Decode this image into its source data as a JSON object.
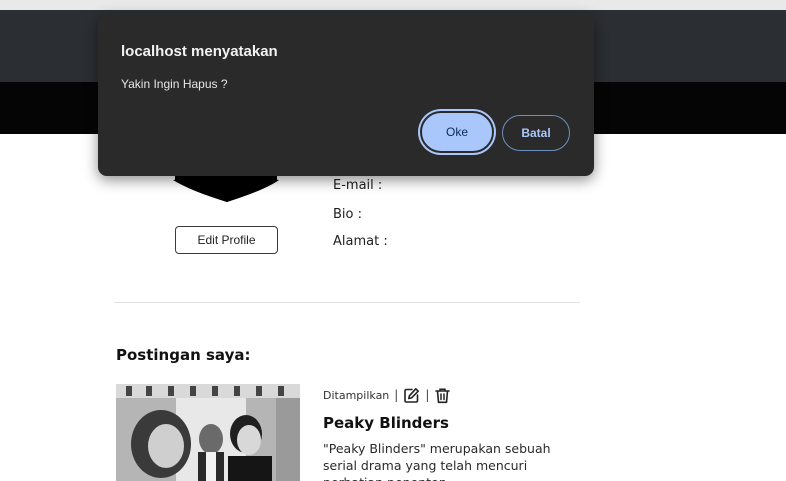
{
  "dialog": {
    "title": "localhost menyatakan",
    "message": "Yakin Ingin Hapus ?",
    "ok_label": "Oke",
    "cancel_label": "Batal"
  },
  "profile": {
    "edit_button": "Edit Profile",
    "email_label": "E-mail :",
    "bio_label": "Bio :",
    "address_label": "Alamat :"
  },
  "posts_section": {
    "title": "Postingan saya:",
    "posts": [
      {
        "status": "Ditampilkan",
        "separator": "|",
        "title": "Peaky Blinders",
        "excerpt": "\"Peaky Blinders\" merupakan sebuah serial drama yang telah mencuri perhatian penonton",
        "icons": [
          "edit-icon",
          "trash-icon"
        ]
      }
    ]
  },
  "colors": {
    "dialog_bg": "#2a2a2b",
    "primary_button": "#a9c7fb",
    "header_dark": "#2b2f33"
  }
}
